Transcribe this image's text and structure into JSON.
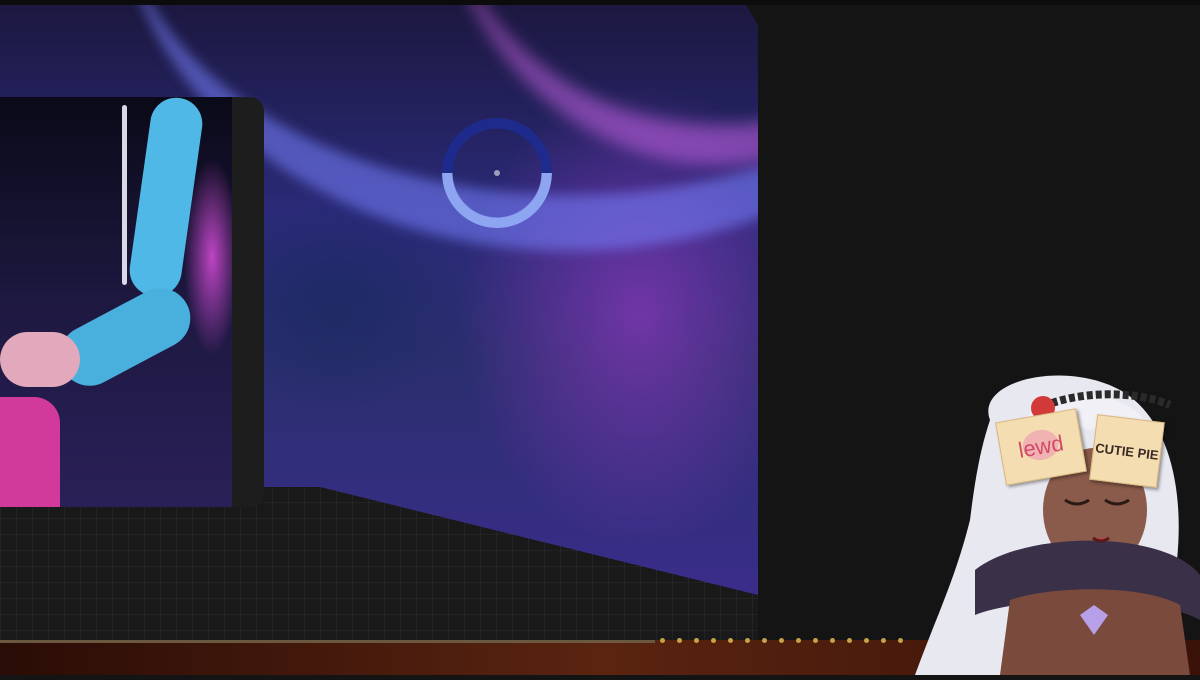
{
  "stream_overlay": {
    "avatar": {
      "stickers": [
        {
          "text": "lewd",
          "color": "#d24a6a"
        },
        {
          "text": "CUTIE PIE",
          "color": "#3a2a26"
        }
      ]
    },
    "colors": {
      "background": "#141414",
      "display_accent": "#2a2a78",
      "ring_dark": "#1e2a8c",
      "ring_light": "#8ea6f2",
      "bottom_bar": "#5a2410",
      "dot": "#c9a14a"
    }
  }
}
